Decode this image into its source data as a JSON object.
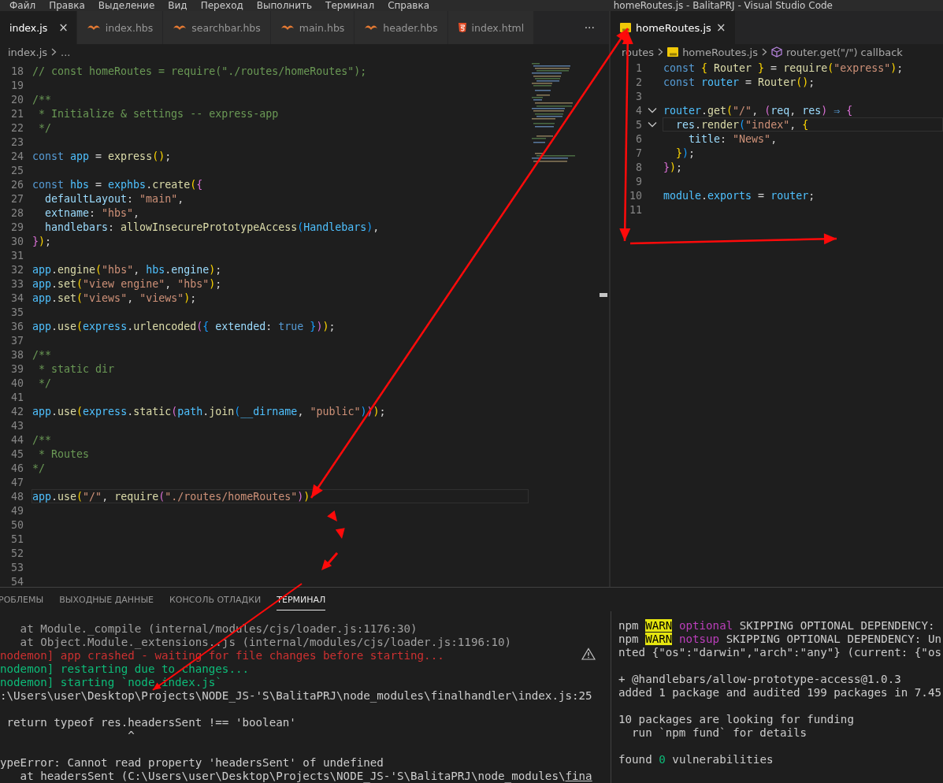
{
  "menu": [
    "Файл",
    "Правка",
    "Выделение",
    "Вид",
    "Переход",
    "Выполнить",
    "Терминал",
    "Справка"
  ],
  "window_title": "homeRoutes.js - BalitaPRJ - Visual Studio Code",
  "left_editor": {
    "tabs": [
      {
        "label": "index.js",
        "selected": true,
        "close": "×"
      },
      {
        "label": "index.hbs",
        "kind": "hbs",
        "selected": false
      },
      {
        "label": "searchbar.hbs",
        "kind": "hbs",
        "selected": false
      },
      {
        "label": "main.hbs",
        "kind": "hbs",
        "selected": false
      },
      {
        "label": "header.hbs",
        "kind": "hbs",
        "selected": false
      },
      {
        "label": "index.html",
        "kind": "html",
        "selected": false
      }
    ],
    "more": "···",
    "breadcrumb": [
      {
        "text": "index.js"
      },
      {
        "text": "..."
      }
    ],
    "lines": [
      {
        "n": "18",
        "tokens": [
          {
            "kind": "comment",
            "text": "// const homeRoutes = require(\"./routes/homeRoutes\");"
          }
        ]
      },
      {
        "n": "19"
      },
      {
        "n": "20",
        "tokens": [
          {
            "kind": "comment",
            "text": "/**"
          }
        ]
      },
      {
        "n": "21",
        "tokens": [
          {
            "kind": "comment",
            "text": " * Initialize & settings -- express-app"
          }
        ]
      },
      {
        "n": "22",
        "tokens": [
          {
            "kind": "comment",
            "text": " */"
          }
        ]
      },
      {
        "n": "23"
      },
      {
        "n": "24",
        "tokens": [
          {
            "kind": "keyword",
            "text": "const"
          },
          {
            "kind": "var",
            "text": " app"
          },
          {
            "kind": "plain",
            "text": " = "
          },
          {
            "kind": "fn",
            "text": "express"
          },
          {
            "kind": "b1",
            "text": "()"
          },
          {
            "kind": "plain",
            "text": ";"
          }
        ]
      },
      {
        "n": "25"
      },
      {
        "n": "26",
        "tokens": [
          {
            "kind": "keyword",
            "text": "const"
          },
          {
            "kind": "var",
            "text": " hbs"
          },
          {
            "kind": "plain",
            "text": " = "
          },
          {
            "kind": "var",
            "text": "exphbs"
          },
          {
            "kind": "plain",
            "text": "."
          },
          {
            "kind": "fn",
            "text": "create"
          },
          {
            "kind": "b1",
            "text": "("
          },
          {
            "kind": "b2",
            "text": "{"
          }
        ]
      },
      {
        "n": "27",
        "tokens": [
          {
            "kind": "prop",
            "text": "  defaultLayout"
          },
          {
            "kind": "plain",
            "text": ": "
          },
          {
            "kind": "str",
            "text": "\"main\""
          },
          {
            "kind": "plain",
            "text": ","
          }
        ]
      },
      {
        "n": "28",
        "tokens": [
          {
            "kind": "prop",
            "text": "  extname"
          },
          {
            "kind": "plain",
            "text": ": "
          },
          {
            "kind": "str",
            "text": "\"hbs\""
          },
          {
            "kind": "plain",
            "text": ","
          }
        ]
      },
      {
        "n": "29",
        "tokens": [
          {
            "kind": "prop",
            "text": "  handlebars"
          },
          {
            "kind": "plain",
            "text": ": "
          },
          {
            "kind": "fn",
            "text": "allowInsecurePrototypeAccess"
          },
          {
            "kind": "b3",
            "text": "("
          },
          {
            "kind": "var",
            "text": "Handlebars"
          },
          {
            "kind": "b3",
            "text": ")"
          },
          {
            "kind": "plain",
            "text": ","
          }
        ]
      },
      {
        "n": "30",
        "tokens": [
          {
            "kind": "b2",
            "text": "}"
          },
          {
            "kind": "b1",
            "text": ")"
          },
          {
            "kind": "plain",
            "text": ";"
          }
        ]
      },
      {
        "n": "31"
      },
      {
        "n": "32",
        "tokens": [
          {
            "kind": "var",
            "text": "app"
          },
          {
            "kind": "plain",
            "text": "."
          },
          {
            "kind": "fn",
            "text": "engine"
          },
          {
            "kind": "b1",
            "text": "("
          },
          {
            "kind": "str",
            "text": "\"hbs\""
          },
          {
            "kind": "plain",
            "text": ", "
          },
          {
            "kind": "var",
            "text": "hbs"
          },
          {
            "kind": "plain",
            "text": "."
          },
          {
            "kind": "prop",
            "text": "engine"
          },
          {
            "kind": "b1",
            "text": ")"
          },
          {
            "kind": "plain",
            "text": ";"
          }
        ]
      },
      {
        "n": "33",
        "tokens": [
          {
            "kind": "var",
            "text": "app"
          },
          {
            "kind": "plain",
            "text": "."
          },
          {
            "kind": "fn",
            "text": "set"
          },
          {
            "kind": "b1",
            "text": "("
          },
          {
            "kind": "str",
            "text": "\"view engine\""
          },
          {
            "kind": "plain",
            "text": ", "
          },
          {
            "kind": "str",
            "text": "\"hbs\""
          },
          {
            "kind": "b1",
            "text": ")"
          },
          {
            "kind": "plain",
            "text": ";"
          }
        ]
      },
      {
        "n": "34",
        "tokens": [
          {
            "kind": "var",
            "text": "app"
          },
          {
            "kind": "plain",
            "text": "."
          },
          {
            "kind": "fn",
            "text": "set"
          },
          {
            "kind": "b1",
            "text": "("
          },
          {
            "kind": "str",
            "text": "\"views\""
          },
          {
            "kind": "plain",
            "text": ", "
          },
          {
            "kind": "str",
            "text": "\"views\""
          },
          {
            "kind": "b1",
            "text": ")"
          },
          {
            "kind": "plain",
            "text": ";"
          }
        ]
      },
      {
        "n": "35"
      },
      {
        "n": "36",
        "tokens": [
          {
            "kind": "var",
            "text": "app"
          },
          {
            "kind": "plain",
            "text": "."
          },
          {
            "kind": "fn",
            "text": "use"
          },
          {
            "kind": "b1",
            "text": "("
          },
          {
            "kind": "var",
            "text": "express"
          },
          {
            "kind": "plain",
            "text": "."
          },
          {
            "kind": "fn",
            "text": "urlencoded"
          },
          {
            "kind": "b2",
            "text": "("
          },
          {
            "kind": "b3",
            "text": "{"
          },
          {
            "kind": "prop",
            "text": " extended"
          },
          {
            "kind": "plain",
            "text": ": "
          },
          {
            "kind": "keyword",
            "text": "true"
          },
          {
            "kind": "b3",
            "text": " }"
          },
          {
            "kind": "b2",
            "text": ")"
          },
          {
            "kind": "b1",
            "text": ")"
          },
          {
            "kind": "plain",
            "text": ";"
          }
        ]
      },
      {
        "n": "37"
      },
      {
        "n": "38",
        "tokens": [
          {
            "kind": "comment",
            "text": "/**"
          }
        ]
      },
      {
        "n": "39",
        "tokens": [
          {
            "kind": "comment",
            "text": " * static dir"
          }
        ]
      },
      {
        "n": "40",
        "tokens": [
          {
            "kind": "comment",
            "text": " */"
          }
        ]
      },
      {
        "n": "41"
      },
      {
        "n": "42",
        "tokens": [
          {
            "kind": "var",
            "text": "app"
          },
          {
            "kind": "plain",
            "text": "."
          },
          {
            "kind": "fn",
            "text": "use"
          },
          {
            "kind": "b1",
            "text": "("
          },
          {
            "kind": "var",
            "text": "express"
          },
          {
            "kind": "plain",
            "text": "."
          },
          {
            "kind": "fn",
            "text": "static"
          },
          {
            "kind": "b2",
            "text": "("
          },
          {
            "kind": "var",
            "text": "path"
          },
          {
            "kind": "plain",
            "text": "."
          },
          {
            "kind": "fn",
            "text": "join"
          },
          {
            "kind": "b3",
            "text": "("
          },
          {
            "kind": "var",
            "text": "__dirname"
          },
          {
            "kind": "plain",
            "text": ", "
          },
          {
            "kind": "str",
            "text": "\"public\""
          },
          {
            "kind": "b3",
            "text": ")"
          },
          {
            "kind": "b2",
            "text": ")"
          },
          {
            "kind": "b1",
            "text": ")"
          },
          {
            "kind": "plain",
            "text": ";"
          }
        ]
      },
      {
        "n": "43"
      },
      {
        "n": "44",
        "tokens": [
          {
            "kind": "comment",
            "text": "/**"
          }
        ]
      },
      {
        "n": "45",
        "tokens": [
          {
            "kind": "comment",
            "text": " * Routes"
          }
        ]
      },
      {
        "n": "46",
        "tokens": [
          {
            "kind": "comment",
            "text": "*/"
          }
        ]
      },
      {
        "n": "47"
      },
      {
        "n": "48",
        "current": true,
        "tokens": [
          {
            "kind": "var",
            "text": "app"
          },
          {
            "kind": "plain",
            "text": "."
          },
          {
            "kind": "fn",
            "text": "use"
          },
          {
            "kind": "b1",
            "text": "("
          },
          {
            "kind": "str",
            "text": "\"/\""
          },
          {
            "kind": "plain",
            "text": ", "
          },
          {
            "kind": "fn",
            "text": "require"
          },
          {
            "kind": "b2",
            "text": "("
          },
          {
            "kind": "str",
            "text": "\"./routes/homeRoutes\""
          },
          {
            "kind": "b2",
            "text": ")"
          },
          {
            "kind": "b1",
            "text": ")"
          }
        ]
      },
      {
        "n": "49"
      },
      {
        "n": "50"
      },
      {
        "n": "51"
      },
      {
        "n": "52"
      },
      {
        "n": "53"
      },
      {
        "n": "54"
      }
    ]
  },
  "right_editor": {
    "tabs": [
      {
        "label": "homeRoutes.js",
        "kind": "js",
        "selected": true,
        "close": "×"
      }
    ],
    "breadcrumb": [
      {
        "text": "routes"
      },
      {
        "text": "homeRoutes.js",
        "kind": "js"
      },
      {
        "text": "router.get(\"/\") callback",
        "kind": "symbol"
      }
    ],
    "lines": [
      {
        "n": "1",
        "tokens": [
          {
            "kind": "keyword",
            "text": "const"
          },
          {
            "kind": "b1",
            "text": " {"
          },
          {
            "kind": "fn",
            "text": " Router"
          },
          {
            "kind": "b1",
            "text": " }"
          },
          {
            "kind": "plain",
            "text": " = "
          },
          {
            "kind": "fn",
            "text": "require"
          },
          {
            "kind": "b1",
            "text": "("
          },
          {
            "kind": "str",
            "text": "\"express\""
          },
          {
            "kind": "b1",
            "text": ")"
          },
          {
            "kind": "plain",
            "text": ";"
          }
        ]
      },
      {
        "n": "2",
        "tokens": [
          {
            "kind": "keyword",
            "text": "const"
          },
          {
            "kind": "var",
            "text": " router"
          },
          {
            "kind": "plain",
            "text": " = "
          },
          {
            "kind": "fn",
            "text": "Router"
          },
          {
            "kind": "b1",
            "text": "()"
          },
          {
            "kind": "plain",
            "text": ";"
          }
        ]
      },
      {
        "n": "3"
      },
      {
        "n": "4",
        "foldable": true,
        "tokens": [
          {
            "kind": "var",
            "text": "router"
          },
          {
            "kind": "plain",
            "text": "."
          },
          {
            "kind": "fn",
            "text": "get"
          },
          {
            "kind": "b1",
            "text": "("
          },
          {
            "kind": "str",
            "text": "\"/\""
          },
          {
            "kind": "plain",
            "text": ", "
          },
          {
            "kind": "b2",
            "text": "("
          },
          {
            "kind": "prop",
            "text": "req"
          },
          {
            "kind": "plain",
            "text": ", "
          },
          {
            "kind": "prop",
            "text": "res"
          },
          {
            "kind": "b2",
            "text": ")"
          },
          {
            "kind": "keyword",
            "text": " ⇒ "
          },
          {
            "kind": "b2",
            "text": "{"
          }
        ]
      },
      {
        "n": "5",
        "foldable": true,
        "current": true,
        "tokens": [
          {
            "kind": "prop",
            "text": "  res"
          },
          {
            "kind": "plain",
            "text": "."
          },
          {
            "kind": "fn",
            "text": "render"
          },
          {
            "kind": "b3",
            "text": "("
          },
          {
            "kind": "str",
            "text": "\"index\""
          },
          {
            "kind": "plain",
            "text": ", "
          },
          {
            "kind": "b1",
            "text": "{"
          }
        ]
      },
      {
        "n": "6",
        "tokens": [
          {
            "kind": "prop",
            "text": "    title"
          },
          {
            "kind": "plain",
            "text": ": "
          },
          {
            "kind": "str",
            "text": "\"News\""
          },
          {
            "kind": "plain",
            "text": ","
          }
        ]
      },
      {
        "n": "7",
        "tokens": [
          {
            "kind": "b1",
            "text": "  }"
          },
          {
            "kind": "b3",
            "text": ")"
          },
          {
            "kind": "plain",
            "text": ";"
          }
        ]
      },
      {
        "n": "8",
        "tokens": [
          {
            "kind": "b2",
            "text": "}"
          },
          {
            "kind": "b1",
            "text": ")"
          },
          {
            "kind": "plain",
            "text": ";"
          }
        ]
      },
      {
        "n": "9"
      },
      {
        "n": "10",
        "tokens": [
          {
            "kind": "var",
            "text": "module"
          },
          {
            "kind": "plain",
            "text": "."
          },
          {
            "kind": "var",
            "text": "exports"
          },
          {
            "kind": "plain",
            "text": " = "
          },
          {
            "kind": "var",
            "text": "router"
          },
          {
            "kind": "plain",
            "text": ";"
          }
        ]
      },
      {
        "n": "11"
      }
    ]
  },
  "panel": {
    "tabs": [
      {
        "label": "РОБЛЕМЫ",
        "selected": false
      },
      {
        "label": "ВЫХОДНЫЕ ДАННЫЕ",
        "selected": false
      },
      {
        "label": "КОНСОЛЬ ОТЛАДКИ",
        "selected": false
      },
      {
        "label": "ТЕРМИНАЛ",
        "selected": true
      }
    ],
    "left_terminal": [
      {
        "kind": "text",
        "segments": [
          {
            "kind": "dim",
            "text": "   at Module._compile (internal/modules/cjs/loader.js:1176:30)"
          }
        ]
      },
      {
        "kind": "text",
        "segments": [
          {
            "kind": "dim",
            "text": "   at Object.Module._extensions..js (internal/modules/cjs/loader.js:1196:10)"
          }
        ]
      },
      {
        "kind": "text",
        "segments": [
          {
            "kind": "red",
            "text": "nodemon] app crashed - waiting for file changes before starting..."
          }
        ]
      },
      {
        "kind": "text",
        "segments": [
          {
            "kind": "green",
            "text": "nodemon] restarting due to changes..."
          }
        ]
      },
      {
        "kind": "text",
        "segments": [
          {
            "kind": "green",
            "text": "nodemon] starting `node index.js`"
          }
        ]
      },
      {
        "kind": "text",
        "segments": [
          {
            "kind": "plain",
            "text": ":\\Users\\user\\Desktop\\Projects\\NODE_JS-'S\\BalitaPRJ\\node_modules\\finalhandler\\index.js:25"
          }
        ]
      },
      {
        "kind": "blank"
      },
      {
        "kind": "text",
        "segments": [
          {
            "kind": "plain",
            "text": " return typeof res.headersSent !== 'boolean'"
          }
        ]
      },
      {
        "kind": "text",
        "segments": [
          {
            "kind": "plain",
            "text": "                   ^"
          }
        ]
      },
      {
        "kind": "blank"
      },
      {
        "kind": "text",
        "segments": [
          {
            "kind": "plain",
            "text": "ypeError: Cannot read property 'headersSent' of undefined"
          }
        ]
      },
      {
        "kind": "text",
        "segments": [
          {
            "kind": "plain",
            "text": "   at headersSent (C:\\Users\\user\\Desktop\\Projects\\NODE_JS-'S\\BalitaPRJ\\node_modules\\"
          },
          {
            "kind": "link",
            "text": "fina"
          }
        ]
      }
    ],
    "right_terminal": [
      {
        "kind": "text",
        "segments": [
          {
            "kind": "plain",
            "text": "npm "
          },
          {
            "kind": "warn",
            "text": "WARN"
          },
          {
            "kind": "magenta",
            "text": " optional"
          },
          {
            "kind": "plain",
            "text": " SKIPPING OPTIONAL DEPENDENCY:"
          }
        ]
      },
      {
        "kind": "text",
        "segments": [
          {
            "kind": "plain",
            "text": "npm "
          },
          {
            "kind": "warn",
            "text": "WARN"
          },
          {
            "kind": "magenta",
            "text": " notsup"
          },
          {
            "kind": "plain",
            "text": " SKIPPING OPTIONAL DEPENDENCY: Un"
          }
        ]
      },
      {
        "kind": "text",
        "segments": [
          {
            "kind": "plain",
            "text": "nted {\"os\":\"darwin\",\"arch\":\"any\"} (current: {\"os"
          }
        ]
      },
      {
        "kind": "blank"
      },
      {
        "kind": "text",
        "segments": [
          {
            "kind": "plain",
            "text": "+ @handlebars/allow-prototype-access@1.0.3"
          }
        ]
      },
      {
        "kind": "text",
        "segments": [
          {
            "kind": "plain",
            "text": "added 1 package and audited 199 packages in 7.45"
          }
        ]
      },
      {
        "kind": "blank"
      },
      {
        "kind": "text",
        "segments": [
          {
            "kind": "plain",
            "text": "10 packages are looking for funding"
          }
        ]
      },
      {
        "kind": "text",
        "segments": [
          {
            "kind": "plain",
            "text": "  run `npm fund` for details"
          }
        ]
      },
      {
        "kind": "blank"
      },
      {
        "kind": "text",
        "segments": [
          {
            "kind": "plain",
            "text": "found "
          },
          {
            "kind": "green",
            "text": "0"
          },
          {
            "kind": "plain",
            "text": " vulnerabilities"
          }
        ]
      }
    ]
  }
}
